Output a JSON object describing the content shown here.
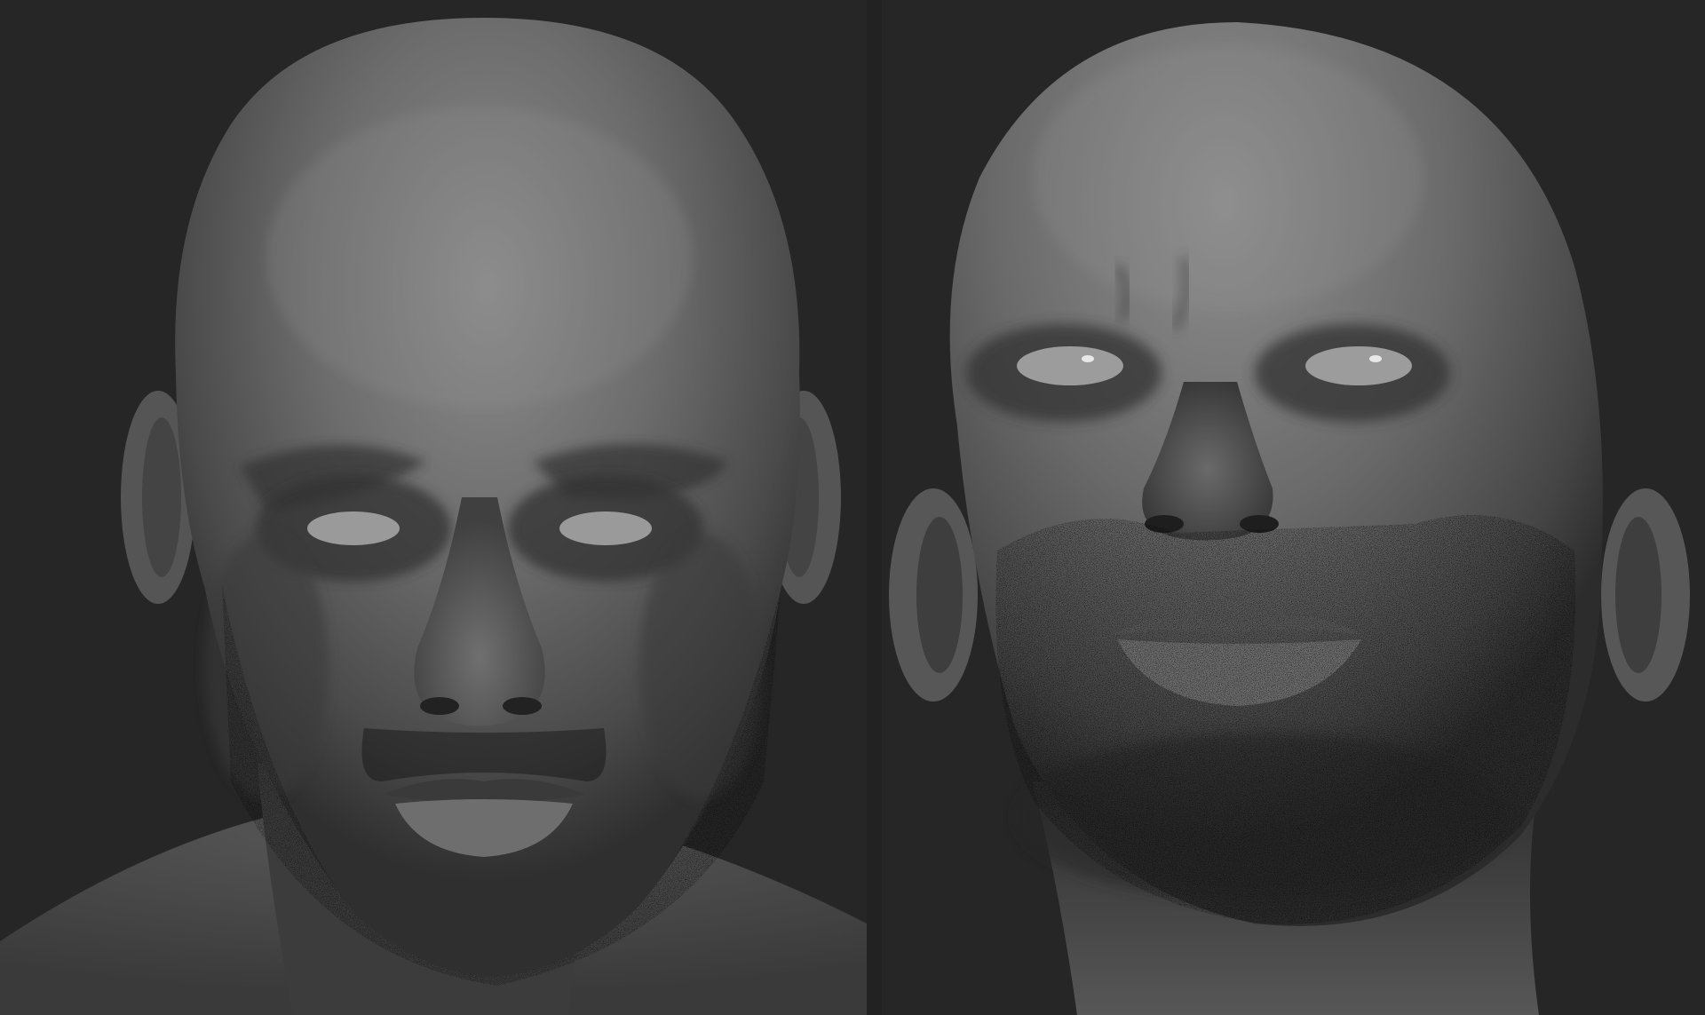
{
  "canvas": {
    "background": "#262626"
  },
  "panels": [
    {
      "name": "front-view",
      "subject": "sculpt-head-front"
    },
    {
      "name": "upward-view",
      "subject": "sculpt-head-looking-up"
    }
  ],
  "colors": {
    "clay_light": "#8a8a8a",
    "clay_mid": "#5f5f5f",
    "clay_dark": "#2e2e2e",
    "stubble": "#0c0c0c",
    "eye": "#9a9a9a"
  }
}
